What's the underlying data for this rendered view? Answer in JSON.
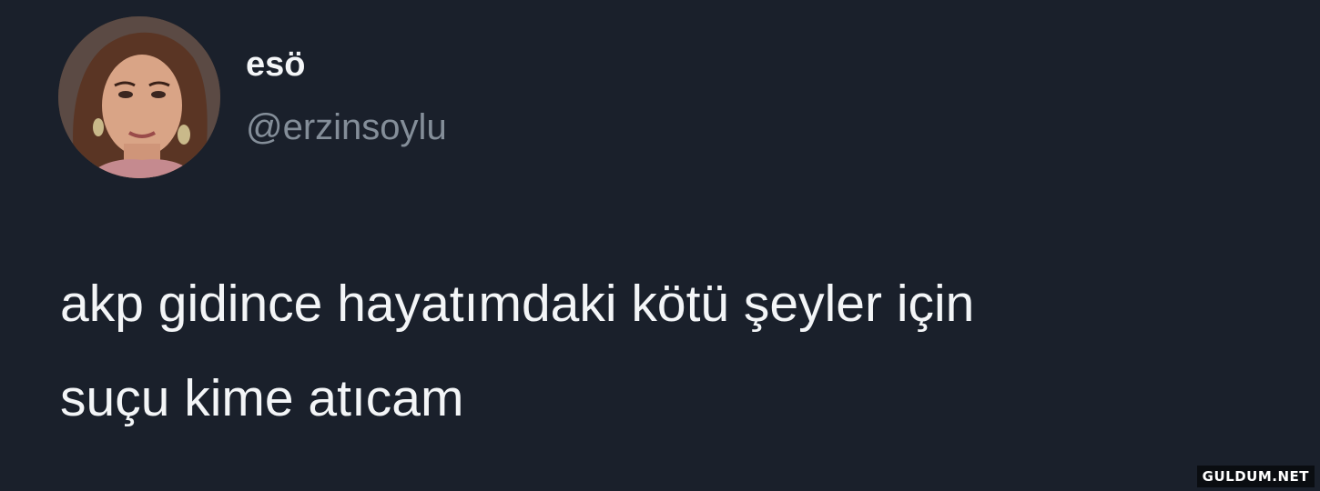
{
  "author": {
    "display_name": "esö",
    "handle": "@erzinsoylu",
    "avatar_icon": "profile-photo"
  },
  "tweet": {
    "text": "akp gidince hayatımdaki kötü şeyler için\nsuçu kime atıcam"
  },
  "watermark": {
    "text": "GULDUM.NET"
  },
  "colors": {
    "background": "#1a202b",
    "primary_text": "#f3f5f7",
    "secondary_text": "#848e99"
  }
}
